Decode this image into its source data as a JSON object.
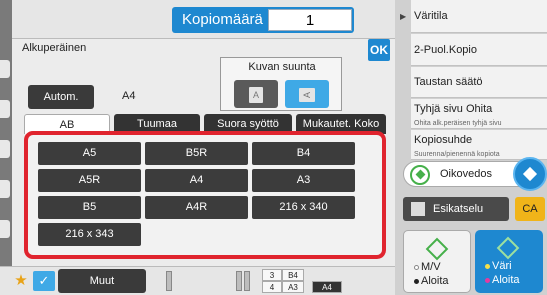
{
  "header": {
    "copies_label": "Kopiomäärä",
    "copies_value": "1"
  },
  "panel": {
    "title": "Alkuperäinen",
    "ok_label": "OK",
    "orientation_label": "Kuvan suunta",
    "portrait_glyph": "A",
    "landscape_glyph": "A",
    "auto_label": "Autom.",
    "auto_size": "A4",
    "tabs": [
      "AB",
      "Tuumaa",
      "Suora syöttö",
      "Mukautet. Koko"
    ],
    "sizes": [
      "A5",
      "B5R",
      "B4",
      "A5R",
      "A4",
      "A3",
      "B5",
      "A4R",
      "216 x 340",
      "216 x 343"
    ]
  },
  "bottom": {
    "star_glyph": "★",
    "check_glyph": "✓",
    "muut_label": "Muut",
    "tray_numbers": [
      "3",
      "4"
    ],
    "tray_sizes": [
      "B4",
      "A3"
    ],
    "tray_selected": "A4"
  },
  "sidebar": {
    "arrow_glyph": "▶",
    "items": [
      {
        "label": "Väritila",
        "sub": ""
      },
      {
        "label": "2-Puol.Kopio",
        "sub": ""
      },
      {
        "label": "Taustan säätö",
        "sub": ""
      },
      {
        "label": "Tyhjä sivu Ohita",
        "sub": "Ohita alk.peräisen tyhjä sivu"
      },
      {
        "label": "Kopiosuhde",
        "sub": "Suurenna/pienennä kopiota"
      }
    ],
    "oikovedos": "Oikovedos",
    "esikatselu": "Esikatselu",
    "ca": "CA",
    "mono_start": {
      "line1": "M/V",
      "line2": "Aloita"
    },
    "color_start": {
      "line1": "Väri",
      "line2": "Aloita"
    }
  },
  "colors": {
    "accent": "#1e88d0",
    "frame_red": "#e0242e",
    "start_green": "#46b04a",
    "ca_yellow": "#f0b419"
  }
}
